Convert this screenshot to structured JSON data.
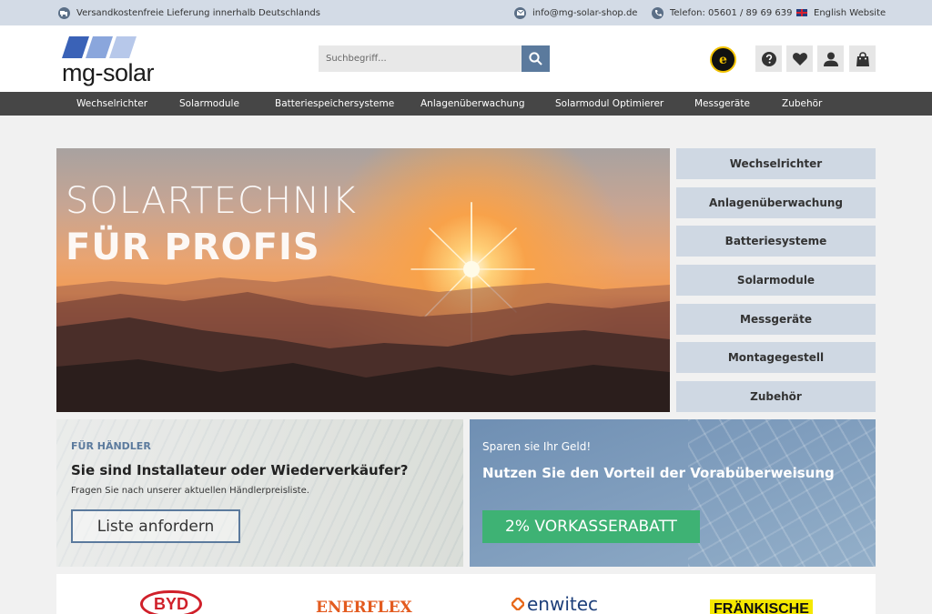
{
  "topbar": {
    "shipping": "Versandkostenfreie Lieferung innerhalb Deutschlands",
    "email": "info@mg-solar-shop.de",
    "phone": "Telefon: 05601 / 89 69 639",
    "english": "English Website"
  },
  "header": {
    "logo_text": "mg-solar",
    "search_placeholder": "Suchbegriff...",
    "trust_badge": "e"
  },
  "nav": {
    "items": [
      "Wechselrichter",
      "Solarmodule",
      "Batteriespeichersysteme",
      "Anlagenüberwachung",
      "Solarmodul Optimierer",
      "Messgeräte",
      "Zubehör"
    ]
  },
  "hero": {
    "line1": "SOLARTECHNIK",
    "line2": "FÜR PROFIS"
  },
  "side_categories": [
    "Wechselrichter",
    "Anlagenüberwachung",
    "Batteriesysteme",
    "Solarmodule",
    "Messgeräte",
    "Montagegestell",
    "Zubehör"
  ],
  "promo_left": {
    "eyebrow": "FÜR HÄNDLER",
    "title": "Sie sind Installateur oder Wiederverkäufer?",
    "subtitle": "Fragen Sie nach unserer aktuellen Händlerpreisliste.",
    "button": "Liste anfordern"
  },
  "promo_right": {
    "eyebrow": "Sparen sie Ihr Geld!",
    "title": "Nutzen Sie den Vorteil der Vorabüberweisung",
    "button": "2% VORKASSERABATT"
  },
  "brands": [
    "BYD",
    "ENERFLEX",
    "enwitec",
    "FRÄNKISCHE"
  ],
  "colors": {
    "topbar_bg": "#d3dbe6",
    "nav_bg": "#464646",
    "accent_blue": "#5b7a9d",
    "side_btn_bg": "#cfd8e3",
    "green": "#3eb274"
  }
}
